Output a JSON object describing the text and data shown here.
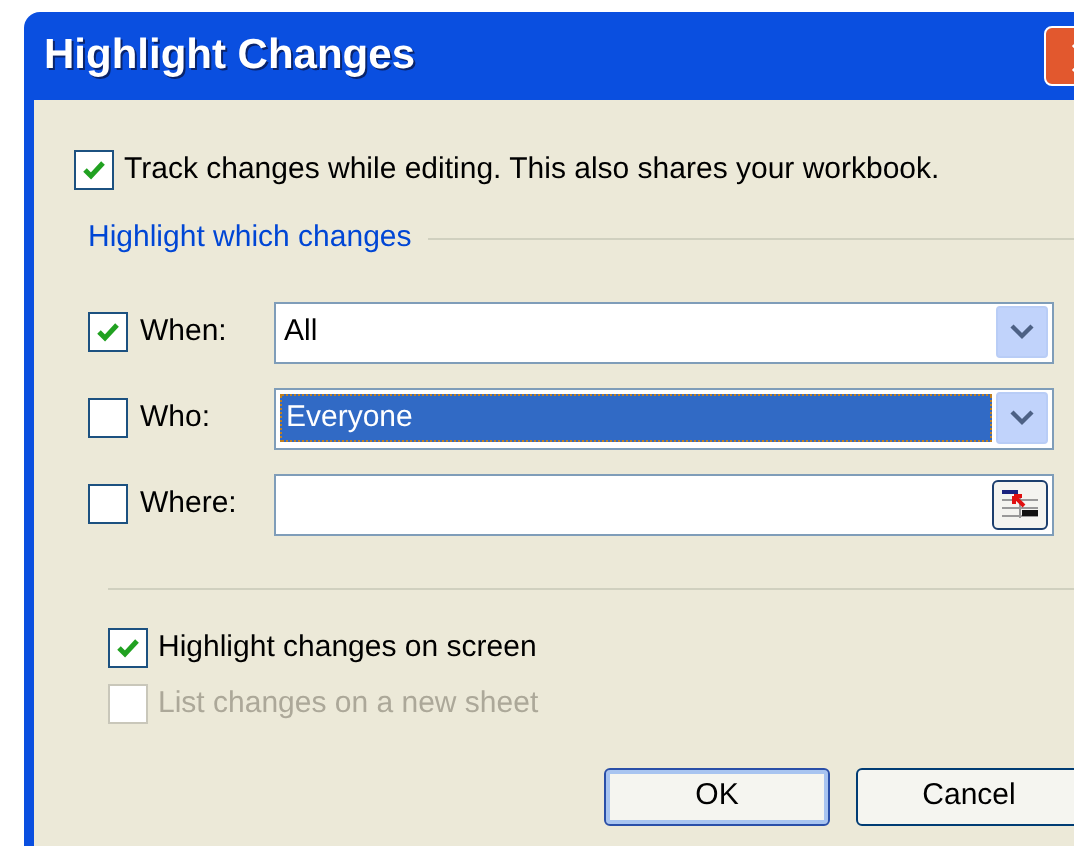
{
  "window": {
    "title": "Highlight Changes"
  },
  "track": {
    "label": "Track changes while editing. This also shares your workbook.",
    "checked": true
  },
  "group": {
    "title": "Highlight which changes"
  },
  "filters": [
    {
      "kind": "dropdown",
      "label": "When:",
      "checked": true,
      "value": "All",
      "selected": false
    },
    {
      "kind": "dropdown",
      "label": "Who:",
      "checked": false,
      "value": "Everyone",
      "selected": true
    },
    {
      "kind": "range",
      "label": "Where:",
      "checked": false
    }
  ],
  "options": [
    {
      "label": "Highlight changes on screen",
      "checked": true,
      "disabled": false
    },
    {
      "label": "List changes on a new sheet",
      "checked": false,
      "disabled": true
    }
  ],
  "buttons": [
    {
      "label": "OK",
      "default": true
    },
    {
      "label": "Cancel",
      "default": false
    }
  ]
}
